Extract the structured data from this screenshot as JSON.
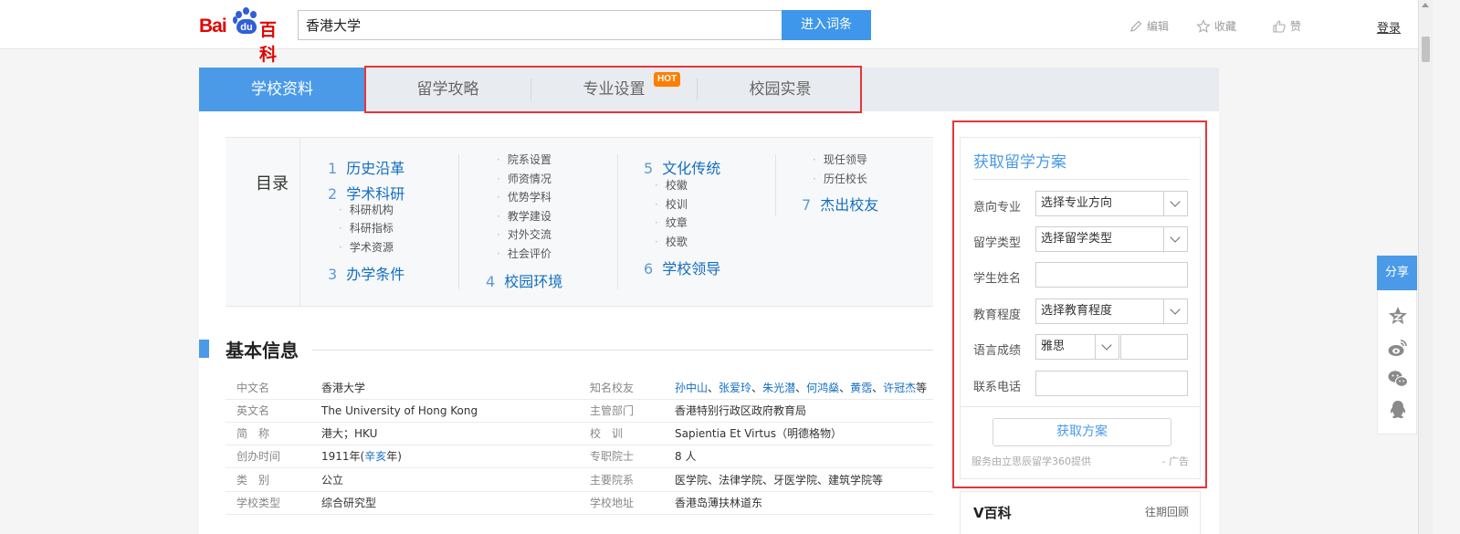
{
  "header": {
    "logo": {
      "bai": "Bai",
      "du": "du",
      "baike": "百科"
    },
    "search_value": "香港大学",
    "search_button": "进入词条",
    "edit": "编辑",
    "collect": "收藏",
    "like": "赞",
    "login": "登录"
  },
  "tabs": [
    {
      "label": "学校资料"
    },
    {
      "label": "留学攻略"
    },
    {
      "label": "专业设置",
      "badge": "HOT"
    },
    {
      "label": "校园实景"
    }
  ],
  "catalog": {
    "title": "目录",
    "items": [
      {
        "num": "1",
        "label": "历史沿革"
      },
      {
        "num": "2",
        "label": "学术科研",
        "children": [
          "科研机构",
          "科研指标",
          "学术资源"
        ]
      },
      {
        "num": "3",
        "label": "办学条件",
        "children": [
          "院系设置",
          "师资情况",
          "优势学科",
          "教学建设",
          "对外交流",
          "社会评价"
        ]
      },
      {
        "num": "4",
        "label": "校园环境"
      },
      {
        "num": "5",
        "label": "文化传统",
        "children": [
          "校徽",
          "校训",
          "纹章",
          "校歌"
        ]
      },
      {
        "num": "6",
        "label": "学校领导",
        "children": [
          "现任领导",
          "历任校长"
        ]
      },
      {
        "num": "7",
        "label": "杰出校友"
      }
    ]
  },
  "basic_info": {
    "title": "基本信息",
    "rows": [
      {
        "k1": "中文名",
        "v1": "香港大学",
        "k2": "知名校友",
        "v2_links": [
          "孙中山",
          "张爱玲",
          "朱光潜",
          "何鸿燊",
          "黄霑",
          "许冠杰"
        ],
        "v2_sep": "、",
        "v2_suffix": "等"
      },
      {
        "k1": "英文名",
        "v1": "The University of Hong Kong",
        "k2": "主管部门",
        "v2": "香港特别行政区政府教育局"
      },
      {
        "k1": "简　称",
        "v1": "港大；HKU",
        "k2": "校　训",
        "v2": "Sapientia Et Virtus（明德格物）"
      },
      {
        "k1": "创办时间",
        "v1_pre": "1911年(",
        "v1_link": "辛亥",
        "v1_post": "年)",
        "k2": "专职院士",
        "v2": "8 人"
      },
      {
        "k1": "类　别",
        "v1": "公立",
        "k2": "主要院系",
        "v2": "医学院、法律学院、牙医学院、建筑学院等"
      },
      {
        "k1": "学校类型",
        "v1": "综合研究型",
        "k2": "学校地址",
        "v2": "香港岛薄扶林道东"
      }
    ]
  },
  "form": {
    "title": "获取留学方案",
    "fields": [
      {
        "label": "意向专业",
        "type": "select",
        "value": "选择专业方向"
      },
      {
        "label": "留学类型",
        "type": "select",
        "value": "选择留学类型"
      },
      {
        "label": "学生姓名",
        "type": "input",
        "value": ""
      },
      {
        "label": "教育程度",
        "type": "select",
        "value": "选择教育程度"
      },
      {
        "label": "语言成绩",
        "type": "select-input",
        "value": "雅思"
      },
      {
        "label": "联系电话",
        "type": "input",
        "value": ""
      }
    ],
    "button": "获取方案",
    "note": "服务由立思辰留学360提供",
    "ad": "- 广告"
  },
  "vbox": {
    "title": "V百科",
    "more": "往期回顾"
  },
  "share": {
    "label": "分享",
    "icons": [
      "qzone-icon",
      "weibo-icon",
      "wechat-icon",
      "qq-icon"
    ]
  },
  "colors": {
    "accent": "#4a9ae8",
    "link": "#136ec2",
    "highlight": "#e5353a",
    "hot": "#ff7e00"
  }
}
